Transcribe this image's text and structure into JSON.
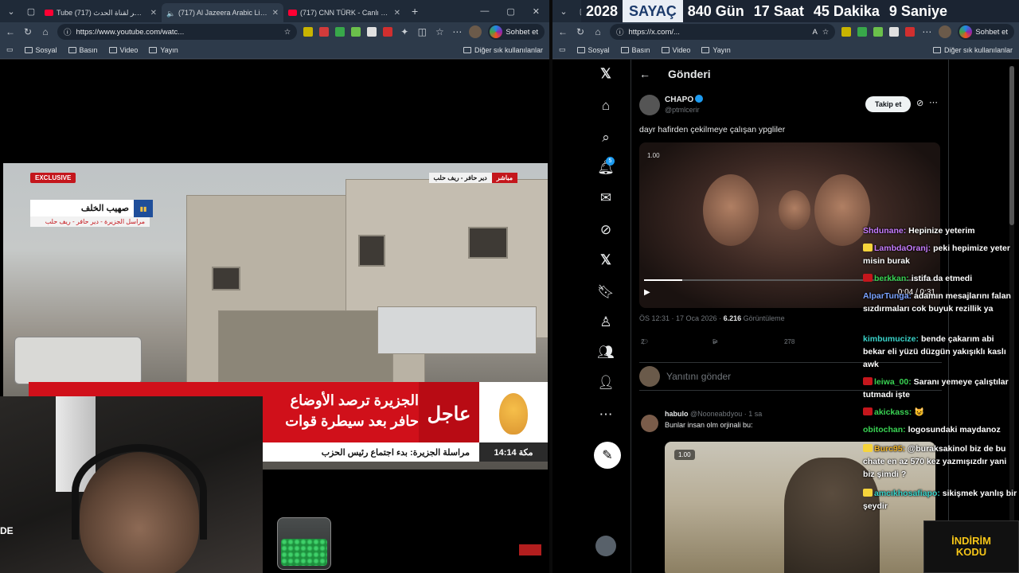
{
  "left_browser": {
    "tabs": [
      {
        "title": "Tube البث المباشر لقناة الحدث (717)",
        "active": false
      },
      {
        "title": "(717) Al Jazeera Arabic Live قناة",
        "active": true
      },
      {
        "title": "(717) CNN TÜRK - Canlı Yayın",
        "active": false
      }
    ],
    "url": "https://www.youtube.com/watc...",
    "copilot_label": "Sohbet et",
    "bookmarks": [
      "Sosyal",
      "Basın",
      "Video",
      "Yayın"
    ],
    "bookmarks_more": "Diğer sık kullanılanlar"
  },
  "right_browser": {
    "url": "https://x.com/...",
    "copilot_label": "Sohbet et",
    "bookmarks": [
      "Sosyal",
      "Basın",
      "Video",
      "Yayın"
    ],
    "bookmarks_more": "Diğer sık kullanılanlar"
  },
  "counter": {
    "year": "2028",
    "label": "SAYAÇ",
    "days": "840 Gün",
    "hours": "17 Saat",
    "minutes": "45 Dakika",
    "seconds": "9 Saniye"
  },
  "news": {
    "exclusive": "EXCLUSIVE",
    "reporter_name": "صهيب الخلف",
    "reporter_sub": "مراسل الجزيرة - دير حافر - ريف حلب",
    "location": "دير حافر - ريف حلب",
    "live": "مباشر",
    "headline_1": "الجزيرة ترصد الأوضاع",
    "headline_2": "حافر بعد سيطرة قوات",
    "urgent": "عاجل",
    "bottom_line": "مراسلة الجزيرة: بدء اجتماع رئيس الحزب",
    "time": "14:14 مكة"
  },
  "x": {
    "page_title": "Gönderi",
    "author_name": "CHAPO",
    "author_handle": "@ptmlcerir",
    "follow_label": "Takip et",
    "post_text": "dayr hafirden çekilmeye çalışan ypgliler",
    "video_badge": "1.00",
    "video_time": "0:04 / 0:31",
    "progress": 0.13,
    "meta_time": "ÖS 12:31 · 17 Oca 2026 · ",
    "views_count": "6.216",
    "views_label": " Görüntüleme",
    "replies": "2",
    "reposts": "5",
    "likes": "278",
    "reply_placeholder": "Yanıtını gönder",
    "comment": {
      "name": "habulo",
      "handle": "@Nooneabdyou · 1 sa",
      "text": "Bunlar insan olm orjinali bu:",
      "badge": "1.00"
    }
  },
  "chat": [
    {
      "user": "Shdunane:",
      "text": "Hepinize yeterim",
      "color": "#c77dff"
    },
    {
      "user": "LambdaOranj:",
      "text": "peki hepimize yeter misin burak",
      "color": "#c77dff"
    },
    {
      "user": "berkkan:",
      "text": "istifa da etmedi",
      "color": "#39d353"
    },
    {
      "user": "AlparTunga:",
      "text": "adamın mesajlarını falan sızdırmaları cok buyuk rezillik ya",
      "color": "#7aa2ff"
    },
    {
      "user": "kimbumucize:",
      "text": "bende çakarım abi bekar eli yüzü düzgün yakışıklı kaslı awk",
      "color": "#39d3c9"
    },
    {
      "user": "leiwa_00:",
      "text": "Saranı yemeye çalıştılar tutmadı işte",
      "color": "#39d353"
    },
    {
      "user": "akickass:",
      "text": "😺",
      "color": "#39d353"
    },
    {
      "user": "obitochan:",
      "text": "logosundaki maydanoz",
      "color": "#39d353"
    },
    {
      "user": "Burc95:",
      "text": "@buraksakinol biz de bu chate en az 570 kez yazmışızdır yani biz şimdi ?",
      "color": "#f0b429"
    },
    {
      "user": "amcıkhosafiapo:",
      "text": "sikişmek yanlış bir şeydir",
      "color": "#39d3c9"
    }
  ],
  "promo": {
    "line1": "İNDİRİM",
    "line2": "KODU"
  },
  "webcam_caption": "DE"
}
